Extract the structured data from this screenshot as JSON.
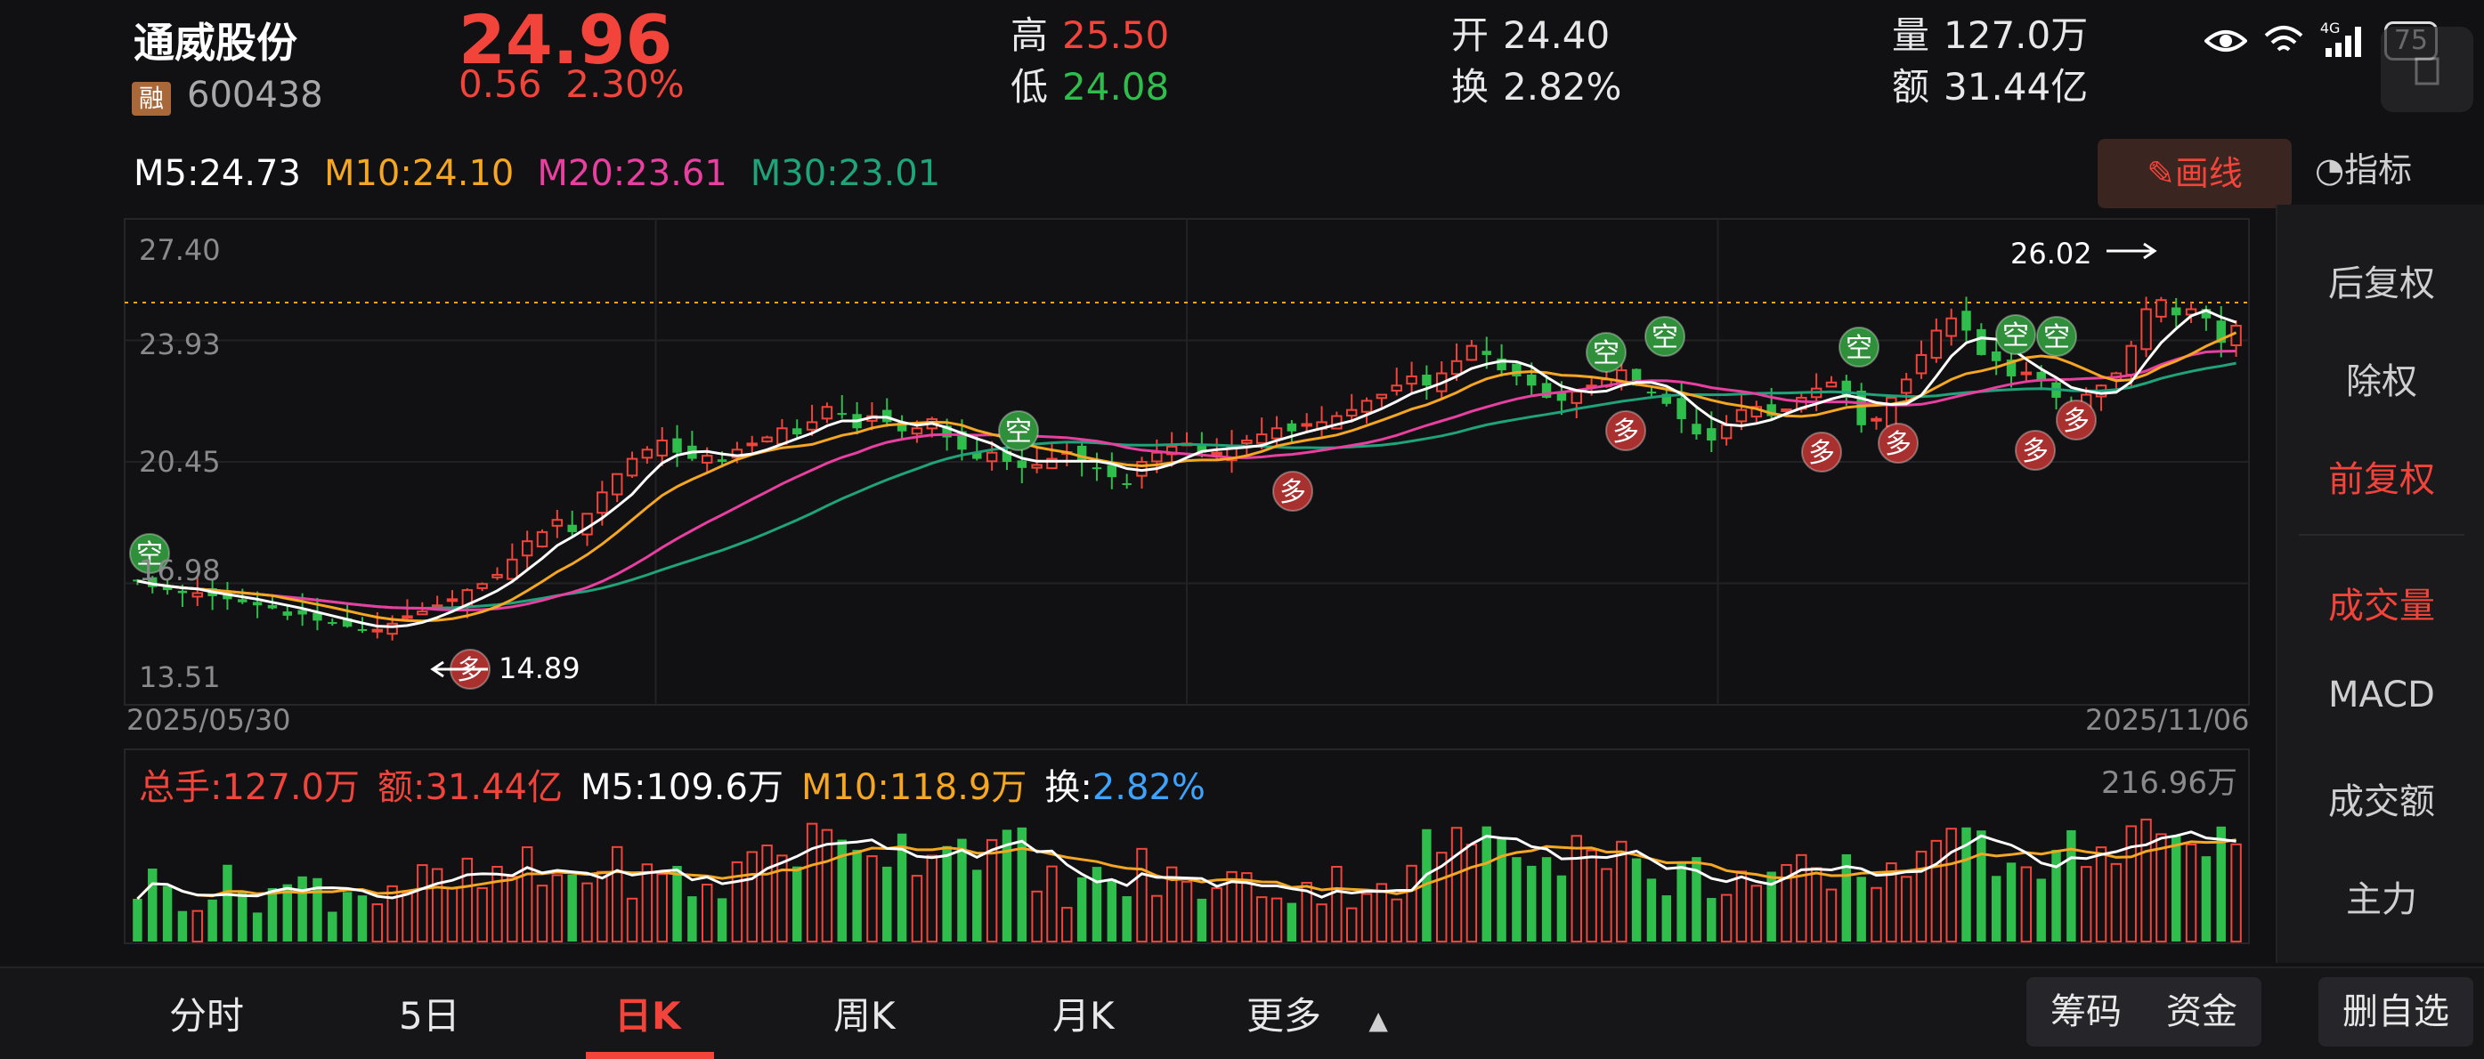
{
  "stock": {
    "name": "通威股份",
    "margin_badge": "融",
    "code": "600438",
    "price": "24.96",
    "change": "0.56",
    "change_pct": "2.30%"
  },
  "quote": {
    "high_label": "高",
    "high": "25.50",
    "low_label": "低",
    "low": "24.08",
    "open_label": "开",
    "open": "24.40",
    "turnover_label": "换",
    "turnover": "2.82%",
    "volume_label": "量",
    "volume": "127.0万",
    "amount_label": "额",
    "amount": "31.44亿"
  },
  "status_bar": {
    "battery": "75",
    "network": "4G"
  },
  "ma_legend": {
    "m5": "M5:24.73",
    "m10": "M10:24.10",
    "m20": "M20:23.61",
    "m30": "M30:23.01"
  },
  "colors": {
    "up": "#f2443a",
    "down": "#2fbd4c",
    "ma5": "#ffffff",
    "ma10": "#f5a623",
    "ma20": "#e83fa0",
    "ma30": "#1fa37a",
    "accent": "#f2443a"
  },
  "toolbar": {
    "draw_label": "画线",
    "indicator_label": "指标"
  },
  "right_panel": {
    "items": [
      "后复权",
      "除权",
      "前复权",
      "成交量",
      "MACD",
      "成交额",
      "主力"
    ],
    "active": [
      "前复权",
      "成交量"
    ]
  },
  "price_axis": [
    "27.40",
    "23.93",
    "20.45",
    "16.98",
    "13.51"
  ],
  "date_axis": {
    "start": "2025/05/30",
    "end": "2025/11/06"
  },
  "annotations": {
    "high_marker": "26.02",
    "low_marker": "14.89",
    "long_label": "多",
    "short_label": "空"
  },
  "volume_legend": {
    "total": "总手:127.0万",
    "amount": "额:31.44亿",
    "m5": "M5:109.6万",
    "m10": "M10:118.9万",
    "turnover_label": "换:",
    "turnover": "2.82%",
    "max": "216.96万"
  },
  "bottom_tabs": {
    "items": [
      "分时",
      "5日",
      "日K",
      "周K",
      "月K",
      "更多"
    ],
    "active": "日K",
    "buttons": [
      "筹码",
      "资金",
      "删自选"
    ]
  },
  "chart_data": {
    "type": "candlestick",
    "start_date": "2025/05/30",
    "end_date": "2025/11/06",
    "ylim": [
      13.51,
      27.4
    ],
    "closes": [
      16.6,
      16.4,
      16.3,
      16.2,
      16.2,
      16.1,
      16.0,
      15.9,
      15.8,
      15.7,
      15.6,
      15.5,
      15.3,
      15.2,
      15.1,
      15.0,
      15.0,
      15.2,
      15.4,
      15.6,
      15.8,
      16.0,
      16.3,
      16.5,
      16.8,
      17.3,
      17.9,
      18.2,
      18.6,
      18.2,
      18.8,
      19.5,
      20.1,
      20.6,
      20.9,
      21.2,
      20.8,
      20.6,
      20.7,
      20.5,
      20.9,
      21.1,
      21.3,
      21.6,
      21.4,
      21.8,
      22.3,
      22.1,
      21.6,
      22.0,
      21.8,
      21.5,
      21.6,
      21.9,
      21.3,
      20.9,
      20.6,
      20.8,
      20.5,
      20.3,
      20.4,
      20.6,
      20.8,
      20.5,
      20.3,
      20.0,
      19.8,
      20.5,
      20.8,
      21.0,
      21.1,
      20.8,
      20.8,
      21.0,
      21.2,
      21.4,
      21.6,
      21.5,
      21.7,
      21.8,
      22.0,
      22.2,
      22.5,
      22.7,
      23.0,
      23.3,
      23.0,
      23.4,
      23.8,
      24.3,
      24.0,
      23.5,
      23.3,
      23.0,
      22.6,
      22.5,
      22.8,
      23.0,
      23.2,
      23.5,
      23.0,
      22.8,
      22.4,
      21.9,
      21.4,
      21.2,
      21.7,
      22.2,
      22.3,
      22.0,
      22.2,
      22.6,
      22.9,
      23.1,
      22.6,
      21.7,
      21.9,
      22.6,
      23.2,
      24.0,
      24.8,
      25.2,
      24.8,
      24.0,
      23.8,
      23.3,
      23.4,
      23.2,
      22.6,
      22.2,
      22.7,
      23.0,
      23.4,
      24.3,
      25.5,
      25.8,
      25.3,
      25.5,
      25.2,
      24.4,
      24.96
    ],
    "volume_max": "216.96万"
  }
}
